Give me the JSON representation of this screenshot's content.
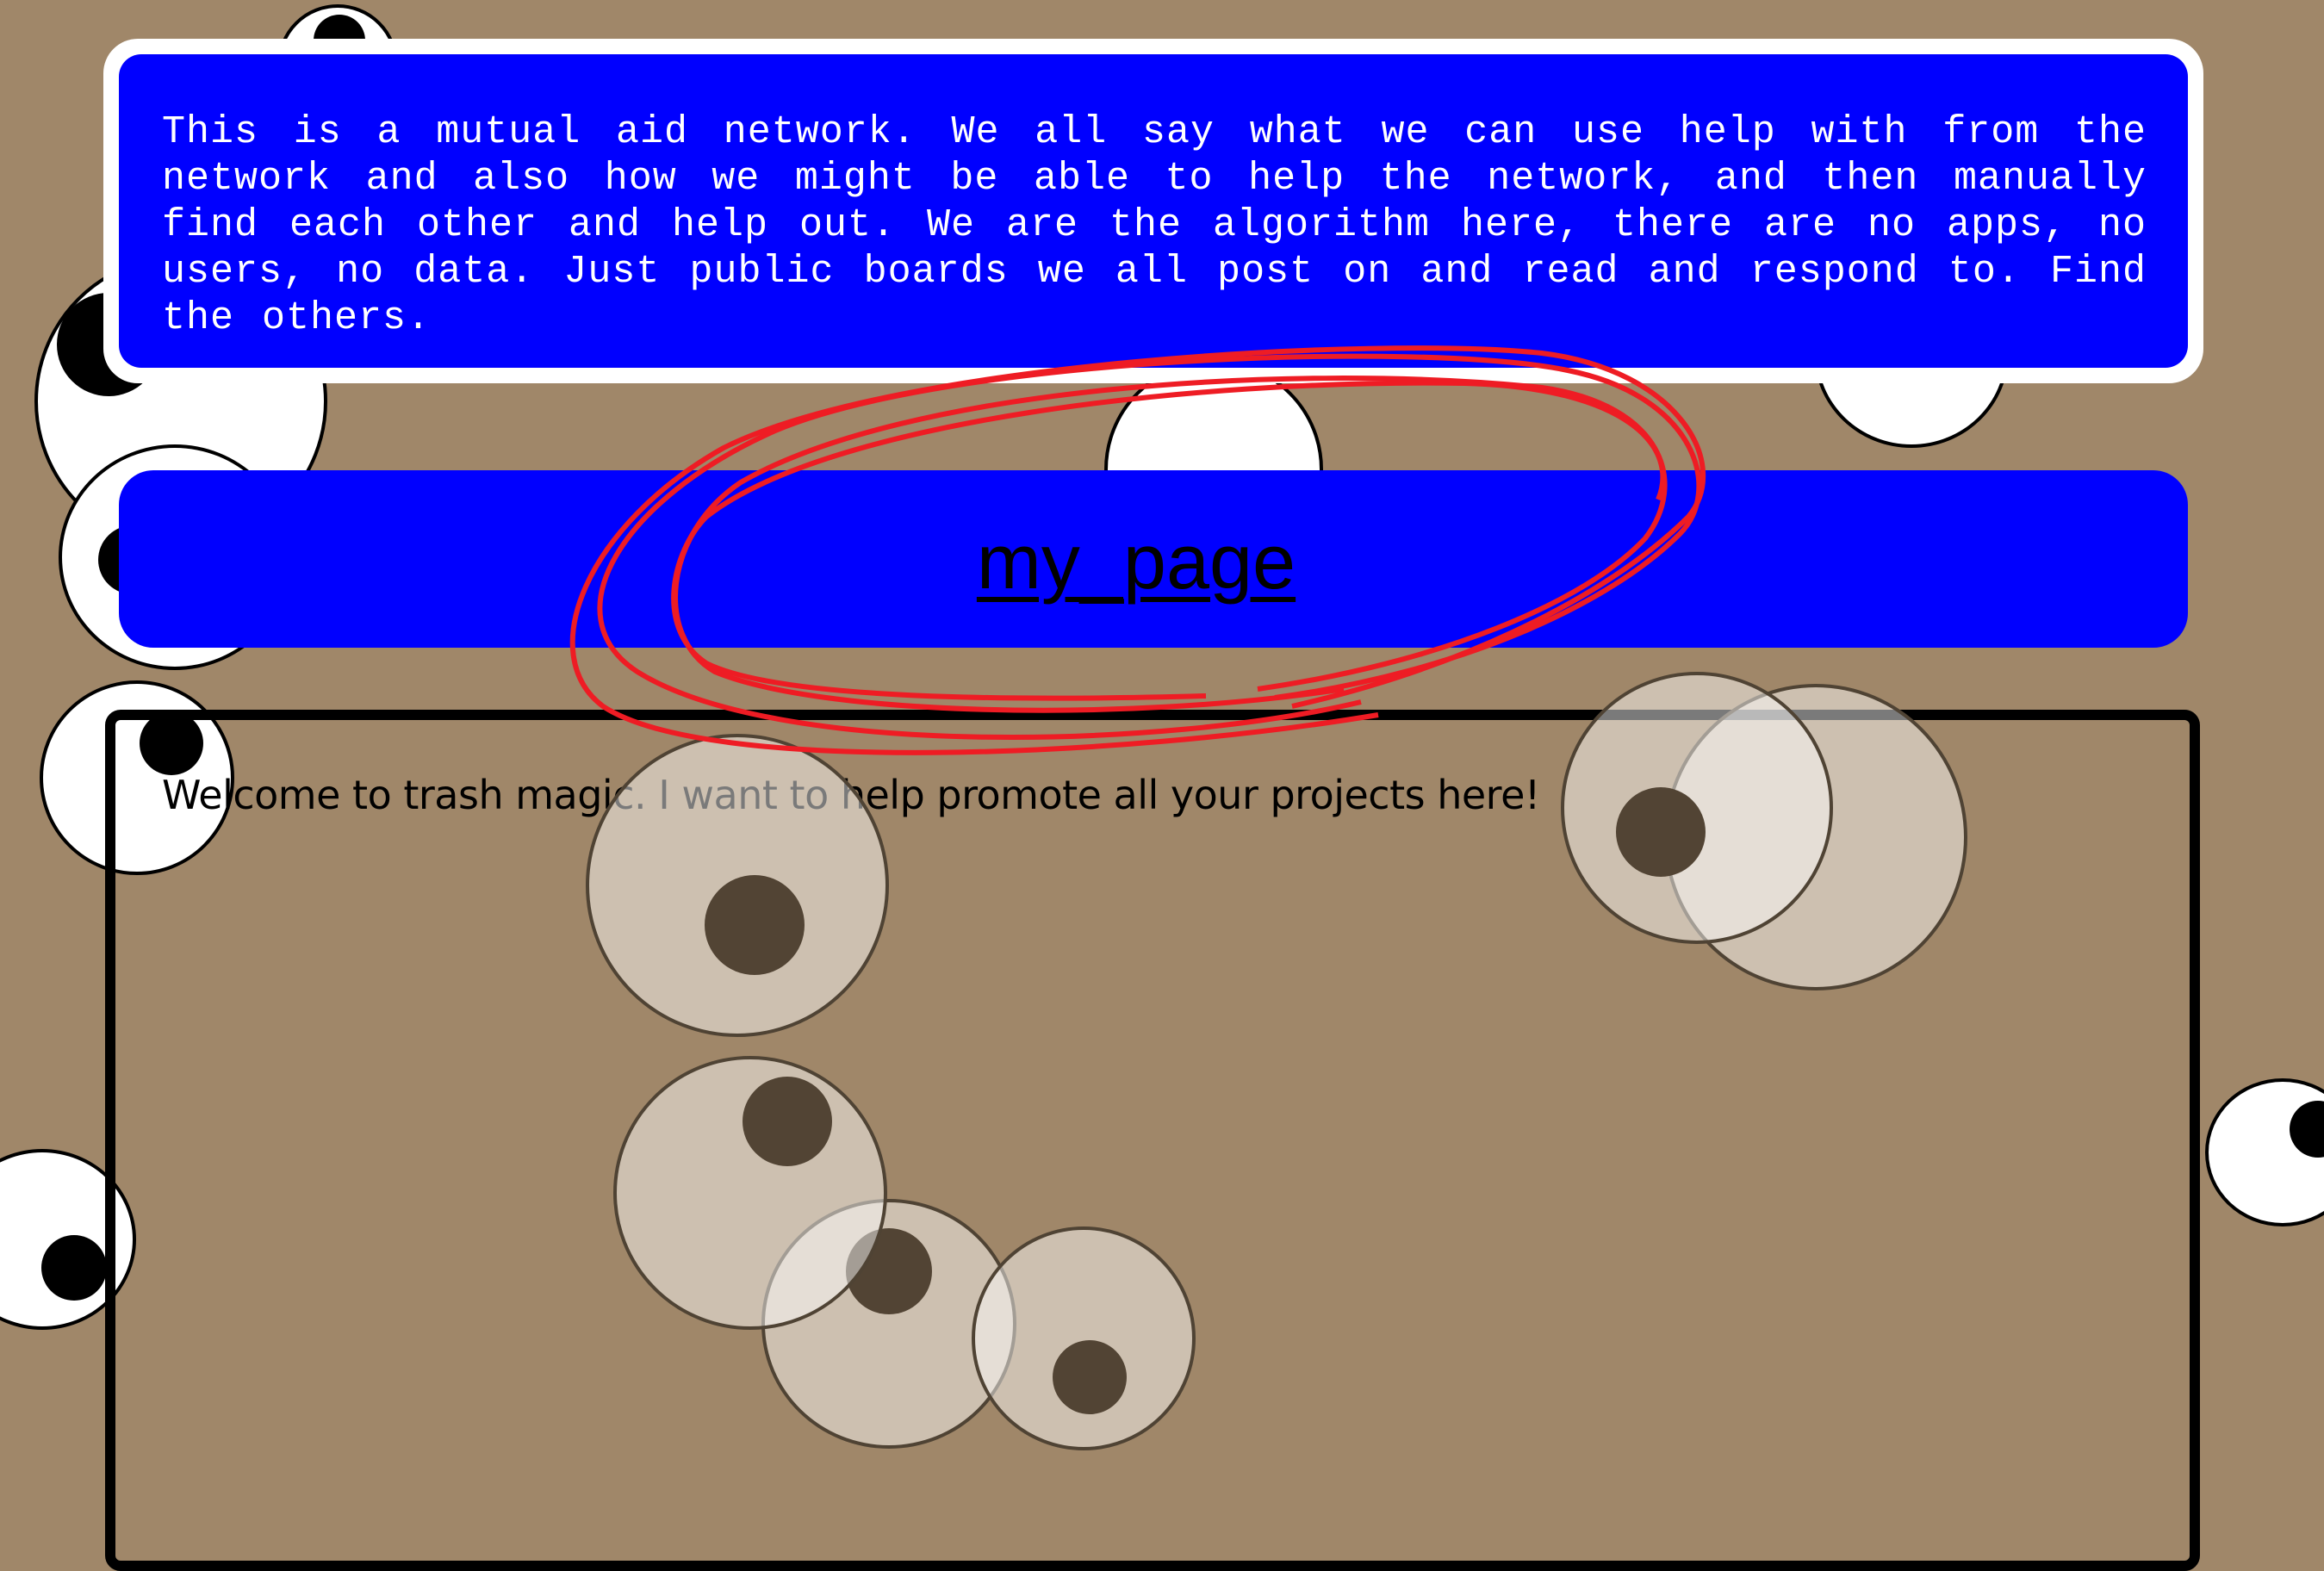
{
  "intro": {
    "text": "This is a mutual aid network. We all say what we can use help with from the network and also how we might be able to help the network, and then manually find each other and help out. We are the algorithm here, there are no apps, no users, no data. Just public boards we all post on and read and respond to. Find the others."
  },
  "nav": {
    "link_label": "my_page"
  },
  "content": {
    "welcome": "Welcome to trash magic.  I want to help promote all your projects here!"
  },
  "colors": {
    "background": "#a08769",
    "panel_blue": "#0000ff",
    "scribble_red": "#ee1c24"
  }
}
